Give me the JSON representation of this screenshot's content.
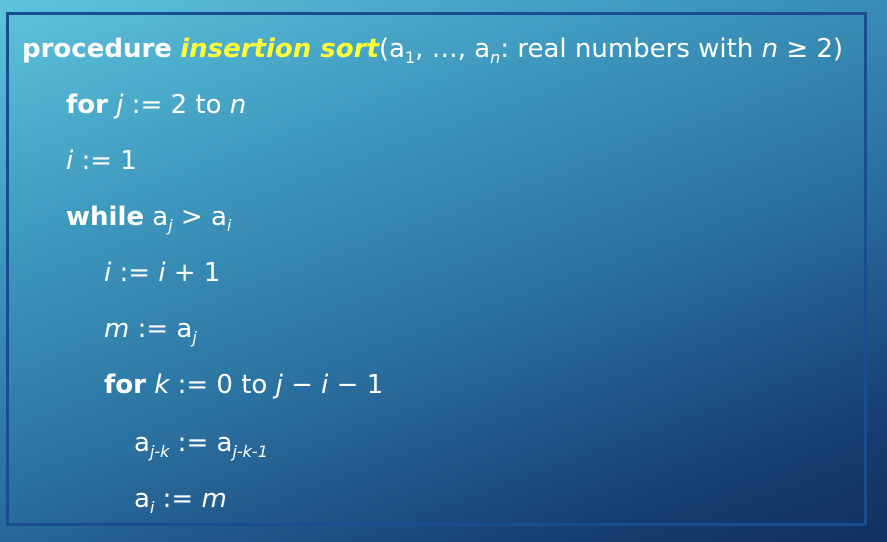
{
  "header": {
    "keyword": "procedure",
    "name": "insertion sort",
    "open": "(a",
    "sub1": "1",
    "mid": ", …, a",
    "subn": "n",
    "rest_a": ": real numbers with ",
    "n": "n",
    "rest_b": " ≥ 2)"
  },
  "lines": {
    "for1_kw": "for",
    "for1_var": "j",
    "for1_rest": " := 2 to ",
    "for1_n": "n",
    "init_var": "i",
    "init_rest": " := 1",
    "while_kw": "while",
    "while_a1": "a",
    "while_sub1": "j",
    "while_op": " > ",
    "while_a2": "a",
    "while_sub2": "i",
    "inc_var1": "i",
    "inc_mid": " := ",
    "inc_var2": "i",
    "inc_rest": " + 1",
    "m_var": "m",
    "m_mid": " := ",
    "m_a": "a",
    "m_sub": "j",
    "for2_kw": "for",
    "for2_var": "k",
    "for2_rest1": " := 0 to ",
    "for2_j": "j",
    "for2_rest2": "  − ",
    "for2_i": "i",
    "for2_rest3": " − 1",
    "shift_a1": "a",
    "shift_sub1": "j-k",
    "shift_mid": " := ",
    "shift_a2": "a",
    "shift_sub2": "j-k-1",
    "assign_a": "a",
    "assign_sub": "i",
    "assign_mid": " := ",
    "assign_m": "m"
  }
}
